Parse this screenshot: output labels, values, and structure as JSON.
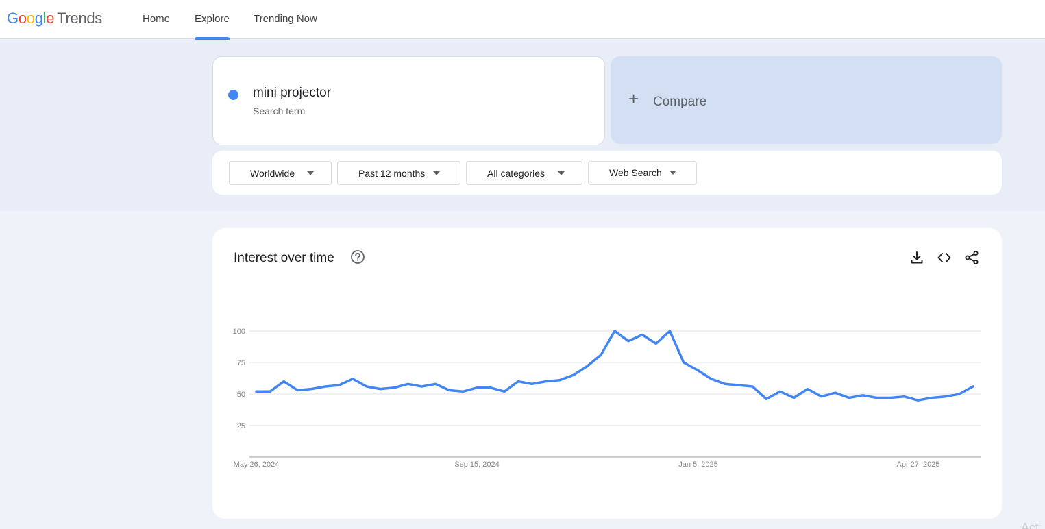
{
  "header": {
    "logo_google": "Google",
    "logo_trends": "Trends",
    "nav": [
      {
        "label": "Home"
      },
      {
        "label": "Explore"
      },
      {
        "label": "Trending Now"
      }
    ]
  },
  "search_term": {
    "name": "mini projector",
    "type": "Search term",
    "color": "#4285f4"
  },
  "compare": {
    "label": "Compare"
  },
  "filters": {
    "region": "Worldwide",
    "period": "Past 12 months",
    "category": "All categories",
    "property": "Web Search"
  },
  "interest_over_time": {
    "title": "Interest over time",
    "icons": [
      "help-icon",
      "download-icon",
      "embed-code-icon",
      "share-icon"
    ]
  },
  "chart_data": {
    "type": "line",
    "title": "Interest over time",
    "xlabel": "",
    "ylabel": "",
    "ylim": [
      0,
      100
    ],
    "yticks": [
      25,
      50,
      75,
      100
    ],
    "xtick_labels": [
      "May 26, 2024",
      "Sep 15, 2024",
      "Jan 5, 2025",
      "Apr 27, 2025"
    ],
    "grid": true,
    "series": [
      {
        "color": "#4285f4",
        "values": [
          52,
          52,
          60,
          53,
          54,
          56,
          57,
          62,
          56,
          54,
          55,
          58,
          56,
          58,
          53,
          52,
          55,
          55,
          52,
          60,
          58,
          60,
          61,
          65,
          72,
          81,
          100,
          92,
          97,
          90,
          100,
          75,
          69,
          62,
          58,
          57,
          56,
          46,
          52,
          47,
          54,
          48,
          51,
          47,
          49,
          47,
          47,
          48,
          45,
          47,
          48,
          50,
          56
        ]
      }
    ]
  }
}
